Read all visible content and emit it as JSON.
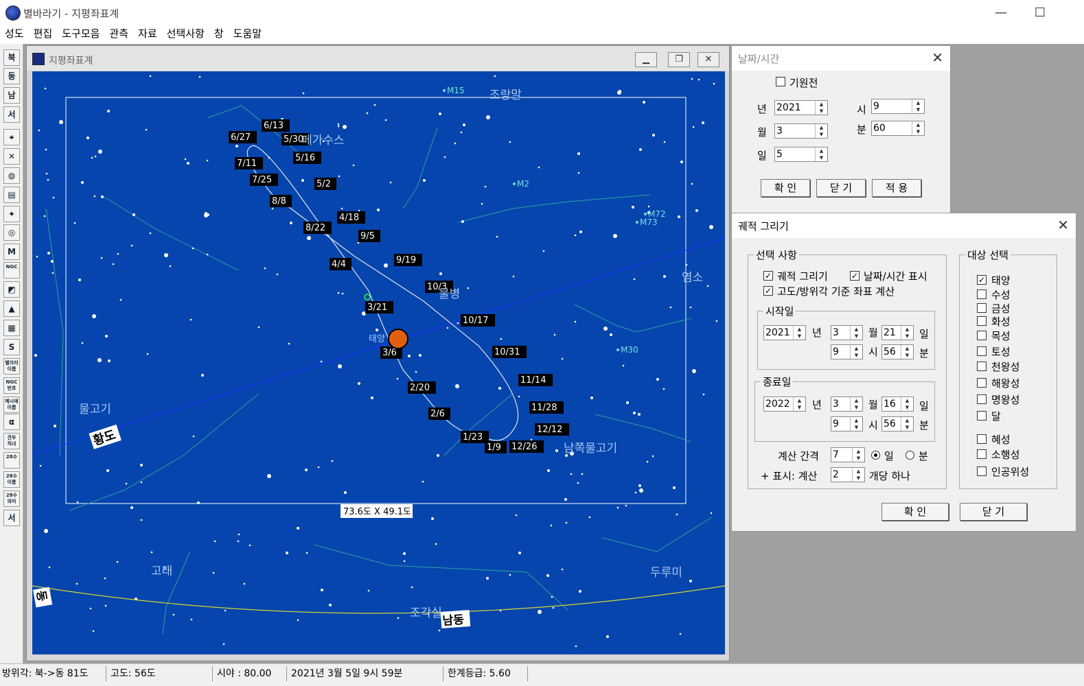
{
  "app": {
    "title": "별바라기 - 지평좌표계",
    "icon": "planet-app-icon"
  },
  "menu": [
    "성도",
    "편집",
    "도구모음",
    "관측",
    "자료",
    "선택사항",
    "창",
    "도움말"
  ],
  "toolbar": [
    {
      "text": "북",
      "name": "tool-north"
    },
    {
      "text": "동",
      "name": "tool-east"
    },
    {
      "text": "남",
      "name": "tool-south"
    },
    {
      "text": "서",
      "name": "tool-west"
    },
    {
      "text": "⌖",
      "name": "tool-center"
    },
    {
      "text": "✕",
      "name": "tool-cross"
    },
    {
      "text": "◍",
      "name": "tool-globe"
    },
    {
      "text": "▤",
      "name": "tool-grid"
    },
    {
      "text": "✦",
      "name": "tool-starfield"
    },
    {
      "text": "◎",
      "name": "tool-galaxy"
    },
    {
      "text": "M",
      "name": "tool-messier"
    },
    {
      "text": "NGC",
      "name": "tool-ngc"
    },
    {
      "text": "◩",
      "name": "tool-milkyway"
    },
    {
      "text": "▲",
      "name": "tool-telescope"
    },
    {
      "text": "▦",
      "name": "tool-photo"
    },
    {
      "text": "S",
      "name": "tool-trajectory"
    },
    {
      "text": "별자리\n이름",
      "name": "tool-constellation-names"
    },
    {
      "text": "NGC\n번호",
      "name": "tool-ngc-numbers"
    },
    {
      "text": "메시에\n이름",
      "name": "tool-messier-names"
    },
    {
      "text": "α",
      "name": "tool-alpha"
    },
    {
      "text": "견우\n직녀",
      "name": "tool-altair-vega"
    },
    {
      "text": "28수",
      "name": "tool-28-mansions"
    },
    {
      "text": "28수\n이름",
      "name": "tool-28-names"
    },
    {
      "text": "28수\n의미",
      "name": "tool-28-meaning"
    },
    {
      "text": "서신",
      "name": "tool-letter"
    }
  ],
  "child": {
    "title": "지평좌표계",
    "fov_label": "73.6도 X 49.1도"
  },
  "sky": {
    "constellations": [
      {
        "name": "조랑말"
      },
      {
        "name": "페가수스"
      },
      {
        "name": "물병"
      },
      {
        "name": "염소"
      },
      {
        "name": "물고기"
      },
      {
        "name": "남쪽물고기"
      },
      {
        "name": "고래"
      },
      {
        "name": "두루미"
      },
      {
        "name": "조각실"
      }
    ],
    "objects": [
      "M15",
      "M2",
      "M72",
      "M73",
      "M30"
    ],
    "sun_label": "태양",
    "ecliptic_label": "황도",
    "directions": [
      "동",
      "남동"
    ],
    "dates": [
      "6/13",
      "6/27",
      "5/30",
      "5/16",
      "7/11",
      "7/25",
      "5/2",
      "8/8",
      "4/18",
      "8/22",
      "9/5",
      "4/4",
      "9/19",
      "10/3",
      "3/21",
      "10/17",
      "3/6",
      "10/31",
      "11/14",
      "2/20",
      "11/28",
      "2/6",
      "12/12",
      "1/23",
      "1/9",
      "12/26"
    ]
  },
  "status": {
    "azimuth": "방위각: 북->동  81도",
    "altitude": "고도:  56도",
    "fov": "시야 : 80.00",
    "datetime": "2021년  3월  5일  9시 59분",
    "limit_mag": "한계등급:  5.60"
  },
  "datetime_dialog": {
    "title": "날짜/시간",
    "bc_label": "기원전",
    "year_label": "년",
    "year": "2021",
    "month_label": "월",
    "month": "3",
    "day_label": "일",
    "day": "5",
    "hour_label": "시",
    "hour": "9",
    "minute_label": "분",
    "minute": "60",
    "ok": "확 인",
    "close": "닫 기",
    "apply": "적 용"
  },
  "track_dialog": {
    "title": "궤적 그리기",
    "options_group": "선택 사항",
    "opt_draw": "궤적 그리기",
    "opt_show_dt": "날짜/시간 표시",
    "opt_altaz": "고도/방위각 기준 좌표 계산",
    "start_group": "시작일",
    "end_group": "종료일",
    "start": {
      "year": "2021",
      "month": "3",
      "day": "21",
      "hour": "9",
      "minute": "56"
    },
    "end": {
      "year": "2022",
      "month": "3",
      "day": "16",
      "hour": "9",
      "minute": "56"
    },
    "u_year": "년",
    "u_month": "월",
    "u_day": "일",
    "u_hour": "시",
    "u_minute": "분",
    "interval_label": "계산 간격",
    "interval": "7",
    "unit_day": "일",
    "unit_min": "분",
    "mark_label": "+ 표시: 계산",
    "mark_value": "2",
    "mark_suffix": "개당 하나",
    "target_group": "대상 선택",
    "targets": [
      "태양",
      "수성",
      "금성",
      "화성",
      "목성",
      "토성",
      "천왕성",
      "해왕성",
      "명왕성",
      "달",
      "혜성",
      "소행성",
      "인공위성"
    ],
    "ok": "확    인",
    "close": "닫    기"
  }
}
